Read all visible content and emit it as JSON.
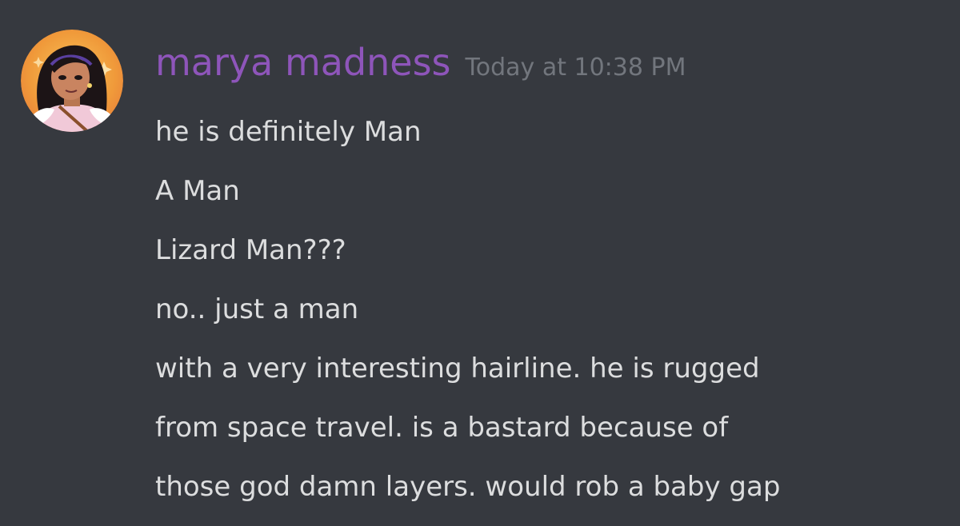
{
  "message": {
    "author": "marya madness",
    "timestamp": "Today at 10:38 PM",
    "author_color": "#8e55ba",
    "avatar_icon": "user-avatar-icon",
    "lines": [
      "he is definitely Man",
      "A Man",
      "Lizard Man???",
      "no.. just a man",
      "with a very interesting hairline. he is rugged",
      "from space travel. is a bastard because of",
      "those god damn layers. would rob a baby gap"
    ]
  },
  "theme": {
    "background": "#36393f",
    "text": "#dcddde",
    "muted": "#72767d"
  }
}
